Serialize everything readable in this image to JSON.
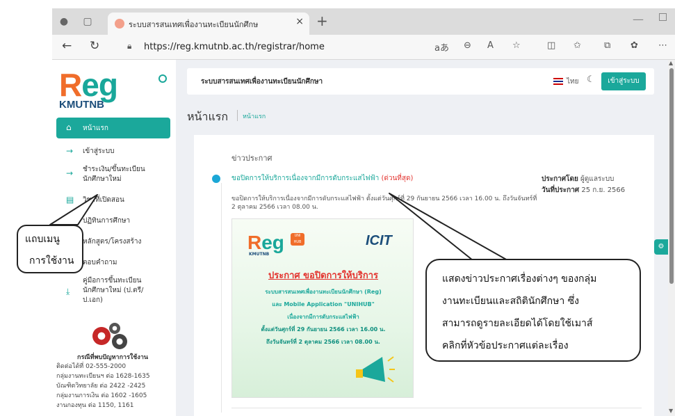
{
  "browser": {
    "tab_title": "ระบบสารสนเทศเพื่องานทะเบียนนักศึกษ",
    "tab_close": "×",
    "new_tab": "+",
    "url": "https://reg.kmutnb.ac.th/registrar/home",
    "read_aloud": "aあ"
  },
  "sidebar": {
    "logo_reg_first": "R",
    "logo_reg_rest": "eg",
    "logo_kmutnb": "KMUTNB",
    "active_item": "หน้าแรก",
    "items": [
      {
        "label": "เข้าสู่ระบบ",
        "icon": "login-icon"
      },
      {
        "label": "ชำระเงิน/ขึ้นทะเบียน นักศึกษาใหม่",
        "icon": "login-icon"
      },
      {
        "label": "วิชาที่เปิดสอน",
        "icon": "book-icon"
      },
      {
        "label": "ปฏิทินการศึกษา",
        "icon": "calendar-icon"
      },
      {
        "label": "หลักสูตร/โครงสร้าง",
        "icon": "list-icon"
      },
      {
        "label": "ตอบคำถาม",
        "icon": "chat-icon"
      },
      {
        "label": "คู่มือการขึ้นทะเบียน นักศึกษาใหม่ (ป.ตรี/ ป.เอก)",
        "icon": "download-icon"
      }
    ],
    "help": {
      "title": "กรณีที่พบปัญหาการใช้งาน",
      "lines": [
        "ติดต่อได้ที่ 02-555-2000",
        "กลุ่มงานทะเบียนฯ ต่อ 1628-1635",
        "บัณฑิตวิทยาลัย ต่อ 2422 -2425",
        "กลุ่มงานการเงิน ต่อ 1602 -1605",
        "งานกองทุน ต่อ 1150, 1161"
      ]
    }
  },
  "topbar": {
    "system_name": "ระบบสารสนเทศเพื่องานทะเบียนนักศึกษา",
    "language": "ไทย",
    "login_button": "เข้าสู่ระบบ"
  },
  "page": {
    "title": "หน้าแรก",
    "breadcrumb": "หน้าแรก"
  },
  "news": {
    "section_label": "ข่าวประกาศ",
    "item": {
      "title": "ขอปิดการให้บริการเนื่องจากมีการดับกระแสไฟฟ้า",
      "urgent": "(ด่วนที่สุด)",
      "posted_by_label": "ประกาศโดย",
      "posted_by": "ผู้ดูแลระบบ",
      "date_label": "วันที่ประกาศ",
      "date": "25 ก.ย. 2566",
      "body": "ขอปิดการให้บริการเนื่องจากมีการดับกระแสไฟฟ้า ตั้งแต่วันศุกร์ที่ 29 กันยายน 2566 เวลา 16.00 น. ถึงวันจันทร์ที่ 2 ตุลาคม 2566 เวลา 08.00 น."
    },
    "poster": {
      "logo_reg_first": "R",
      "logo_reg_rest": "eg",
      "logo_kmutnb": "KMUTNB",
      "unihub": "UNI HUB",
      "icit": "ICIT",
      "title": "ประกาศ ขอปิดการให้บริการ",
      "lines": [
        "ระบบสารสนเทศเพื่องานทะเบียนนักศึกษา (Reg)",
        "และ Mobile Application \"UNIHUB\"",
        "เนื่องจากมีการดับกระแสไฟฟ้า",
        "ตั้งแต่วันศุกร์ที่ 29 กันยายน 2566 เวลา 16.00 น.",
        "ถึงวันจันทร์ที่ 2 ตุลาคม 2566 เวลา 08.00 น."
      ]
    }
  },
  "annotations": {
    "left": [
      "แถบเมนู",
      "การใช้งาน"
    ],
    "right": [
      "แสดงข่าวประกาศเรื่องต่างๆ ของกลุ่ม",
      "งานทะเบียนและสถิตินักศึกษา ซึ่ง",
      "สามารถดูรายละเอียดได้โดยใช้เมาส์",
      "คลิกที่หัวข้อประกาศแต่ละเรื่อง"
    ]
  },
  "colors": {
    "accent": "#1ba89b",
    "brand_orange": "#f06d2a",
    "urgent": "#e3342f"
  }
}
